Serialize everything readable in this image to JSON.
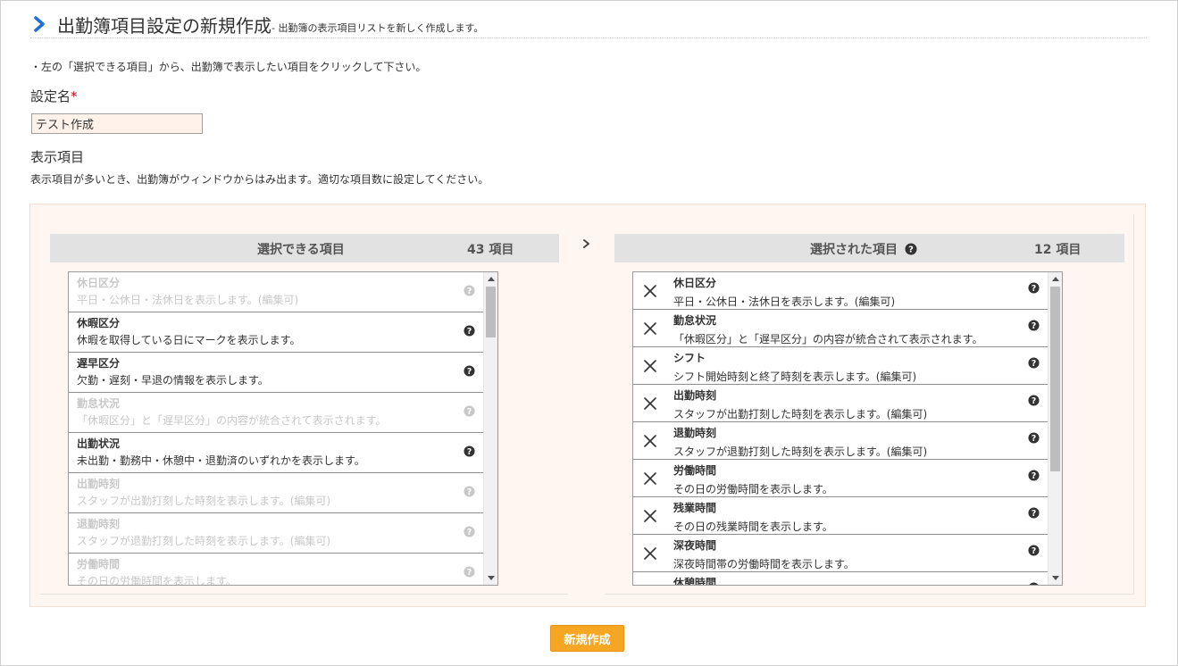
{
  "header": {
    "title": "出勤簿項目設定の新規作成",
    "subtitle": "- 出勤簿の表示項目リストを新しく作成します。"
  },
  "instruction": "・左の「選択できる項目」から、出勤簿で表示したい項目をクリックして下さい。",
  "setting_name": {
    "label": "設定名",
    "required_mark": "*",
    "value": "テスト作成"
  },
  "display_items": {
    "label": "表示項目",
    "hint": "表示項目が多いとき、出勤簿がウィンドウからはみ出ます。適切な項目数に設定してください。"
  },
  "available": {
    "title": "選択できる項目",
    "count": "43 項目",
    "scroll_fraction": 0.18,
    "items": [
      {
        "name": "休日区分",
        "desc": "平日・公休日・法休日を表示します。(編集可)",
        "disabled": true
      },
      {
        "name": "休暇区分",
        "desc": "休暇を取得している日にマークを表示します。",
        "disabled": false
      },
      {
        "name": "遅早区分",
        "desc": "欠勤・遅刻・早退の情報を表示します。",
        "disabled": false
      },
      {
        "name": "勤怠状況",
        "desc": "「休暇区分」と「遅早区分」の内容が統合されて表示されます。",
        "disabled": true
      },
      {
        "name": "出勤状況",
        "desc": "未出勤・勤務中・休憩中・退勤済のいずれかを表示します。",
        "disabled": false
      },
      {
        "name": "出勤時刻",
        "desc": "スタッフが出勤打刻した時刻を表示します。(編集可)",
        "disabled": true
      },
      {
        "name": "退勤時刻",
        "desc": "スタッフが退勤打刻した時刻を表示します。(編集可)",
        "disabled": true
      },
      {
        "name": "労働時間",
        "desc": "その日の労働時間を表示します。",
        "disabled": true
      }
    ]
  },
  "selected": {
    "title": "選択された項目",
    "count": "12 項目",
    "scroll_fraction": 0.65,
    "items": [
      {
        "name": "休日区分",
        "desc": "平日・公休日・法休日を表示します。(編集可)"
      },
      {
        "name": "勤怠状況",
        "desc": "「休暇区分」と「遅早区分」の内容が統合されて表示されます。"
      },
      {
        "name": "シフト",
        "desc": "シフト開始時刻と終了時刻を表示します。(編集可)"
      },
      {
        "name": "出勤時刻",
        "desc": "スタッフが出勤打刻した時刻を表示します。(編集可)"
      },
      {
        "name": "退勤時刻",
        "desc": "スタッフが退勤打刻した時刻を表示します。(編集可)"
      },
      {
        "name": "労働時間",
        "desc": "その日の労働時間を表示します。"
      },
      {
        "name": "残業時間",
        "desc": "その日の残業時間を表示します。"
      },
      {
        "name": "深夜時間",
        "desc": "深夜時間帯の労働時間を表示します。"
      },
      {
        "name": "休憩時間",
        "desc": ""
      }
    ]
  },
  "create_button": "新規作成",
  "colors": {
    "accent_blue": "#1f6fd6",
    "button_orange": "#f5a623",
    "panel_bg": "#fff6f1",
    "input_bg": "#fff2ea",
    "disabled_text": "#c8c8c8"
  },
  "icons": {
    "header": "chevron-right-icon",
    "transfer": "chevron-right-icon",
    "help": "question-circle-icon",
    "remove": "close-icon"
  }
}
